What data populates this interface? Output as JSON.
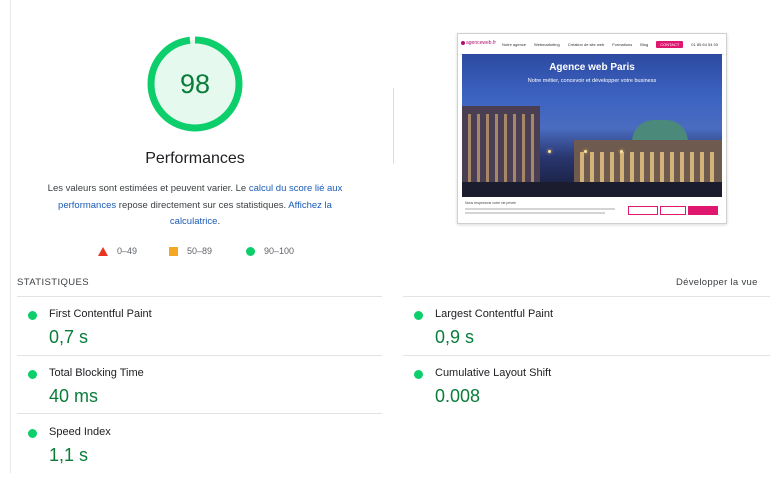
{
  "gauge": {
    "score": "98",
    "score_fraction": 0.98,
    "title": "Performances",
    "ring_color": "#0cce6b",
    "fill_color": "#e6f9ee",
    "text_color": "#0a7d3a"
  },
  "description": {
    "part1": "Les valeurs sont estimées et peuvent varier. Le ",
    "link1": "calcul du score lié aux performances",
    "part2": " repose directement sur ces statistiques. ",
    "link2": "Affichez la calculatrice",
    "part3": "."
  },
  "legend": [
    {
      "shape": "triangle",
      "range": "0–49",
      "color": "#eb3323"
    },
    {
      "shape": "square",
      "range": "50–89",
      "color": "#f5a623"
    },
    {
      "shape": "circle",
      "range": "90–100",
      "color": "#0cce6b"
    }
  ],
  "preview": {
    "logo": "agenceweb.fr",
    "nav": [
      "Notre agence",
      "Webmarketing",
      "Création de site web",
      "Formations",
      "Blog"
    ],
    "nav_cta": "CONTACT",
    "nav_phone": "01 85 64 54 93",
    "hero_title": "Agence web Paris",
    "hero_subtitle": "Notre métier, concevoir et développer votre business",
    "cookie_title": "Nous respectons votre vie privée"
  },
  "stats": {
    "label": "STATISTIQUES",
    "expand": "Développer la vue",
    "metrics": [
      {
        "name": "First Contentful Paint",
        "value": "0,7 s",
        "status": "good"
      },
      {
        "name": "Largest Contentful Paint",
        "value": "0,9 s",
        "status": "good"
      },
      {
        "name": "Total Blocking Time",
        "value": "40 ms",
        "status": "good"
      },
      {
        "name": "Cumulative Layout Shift",
        "value": "0.008",
        "status": "good"
      },
      {
        "name": "Speed Index",
        "value": "1,1 s",
        "status": "good"
      }
    ]
  }
}
